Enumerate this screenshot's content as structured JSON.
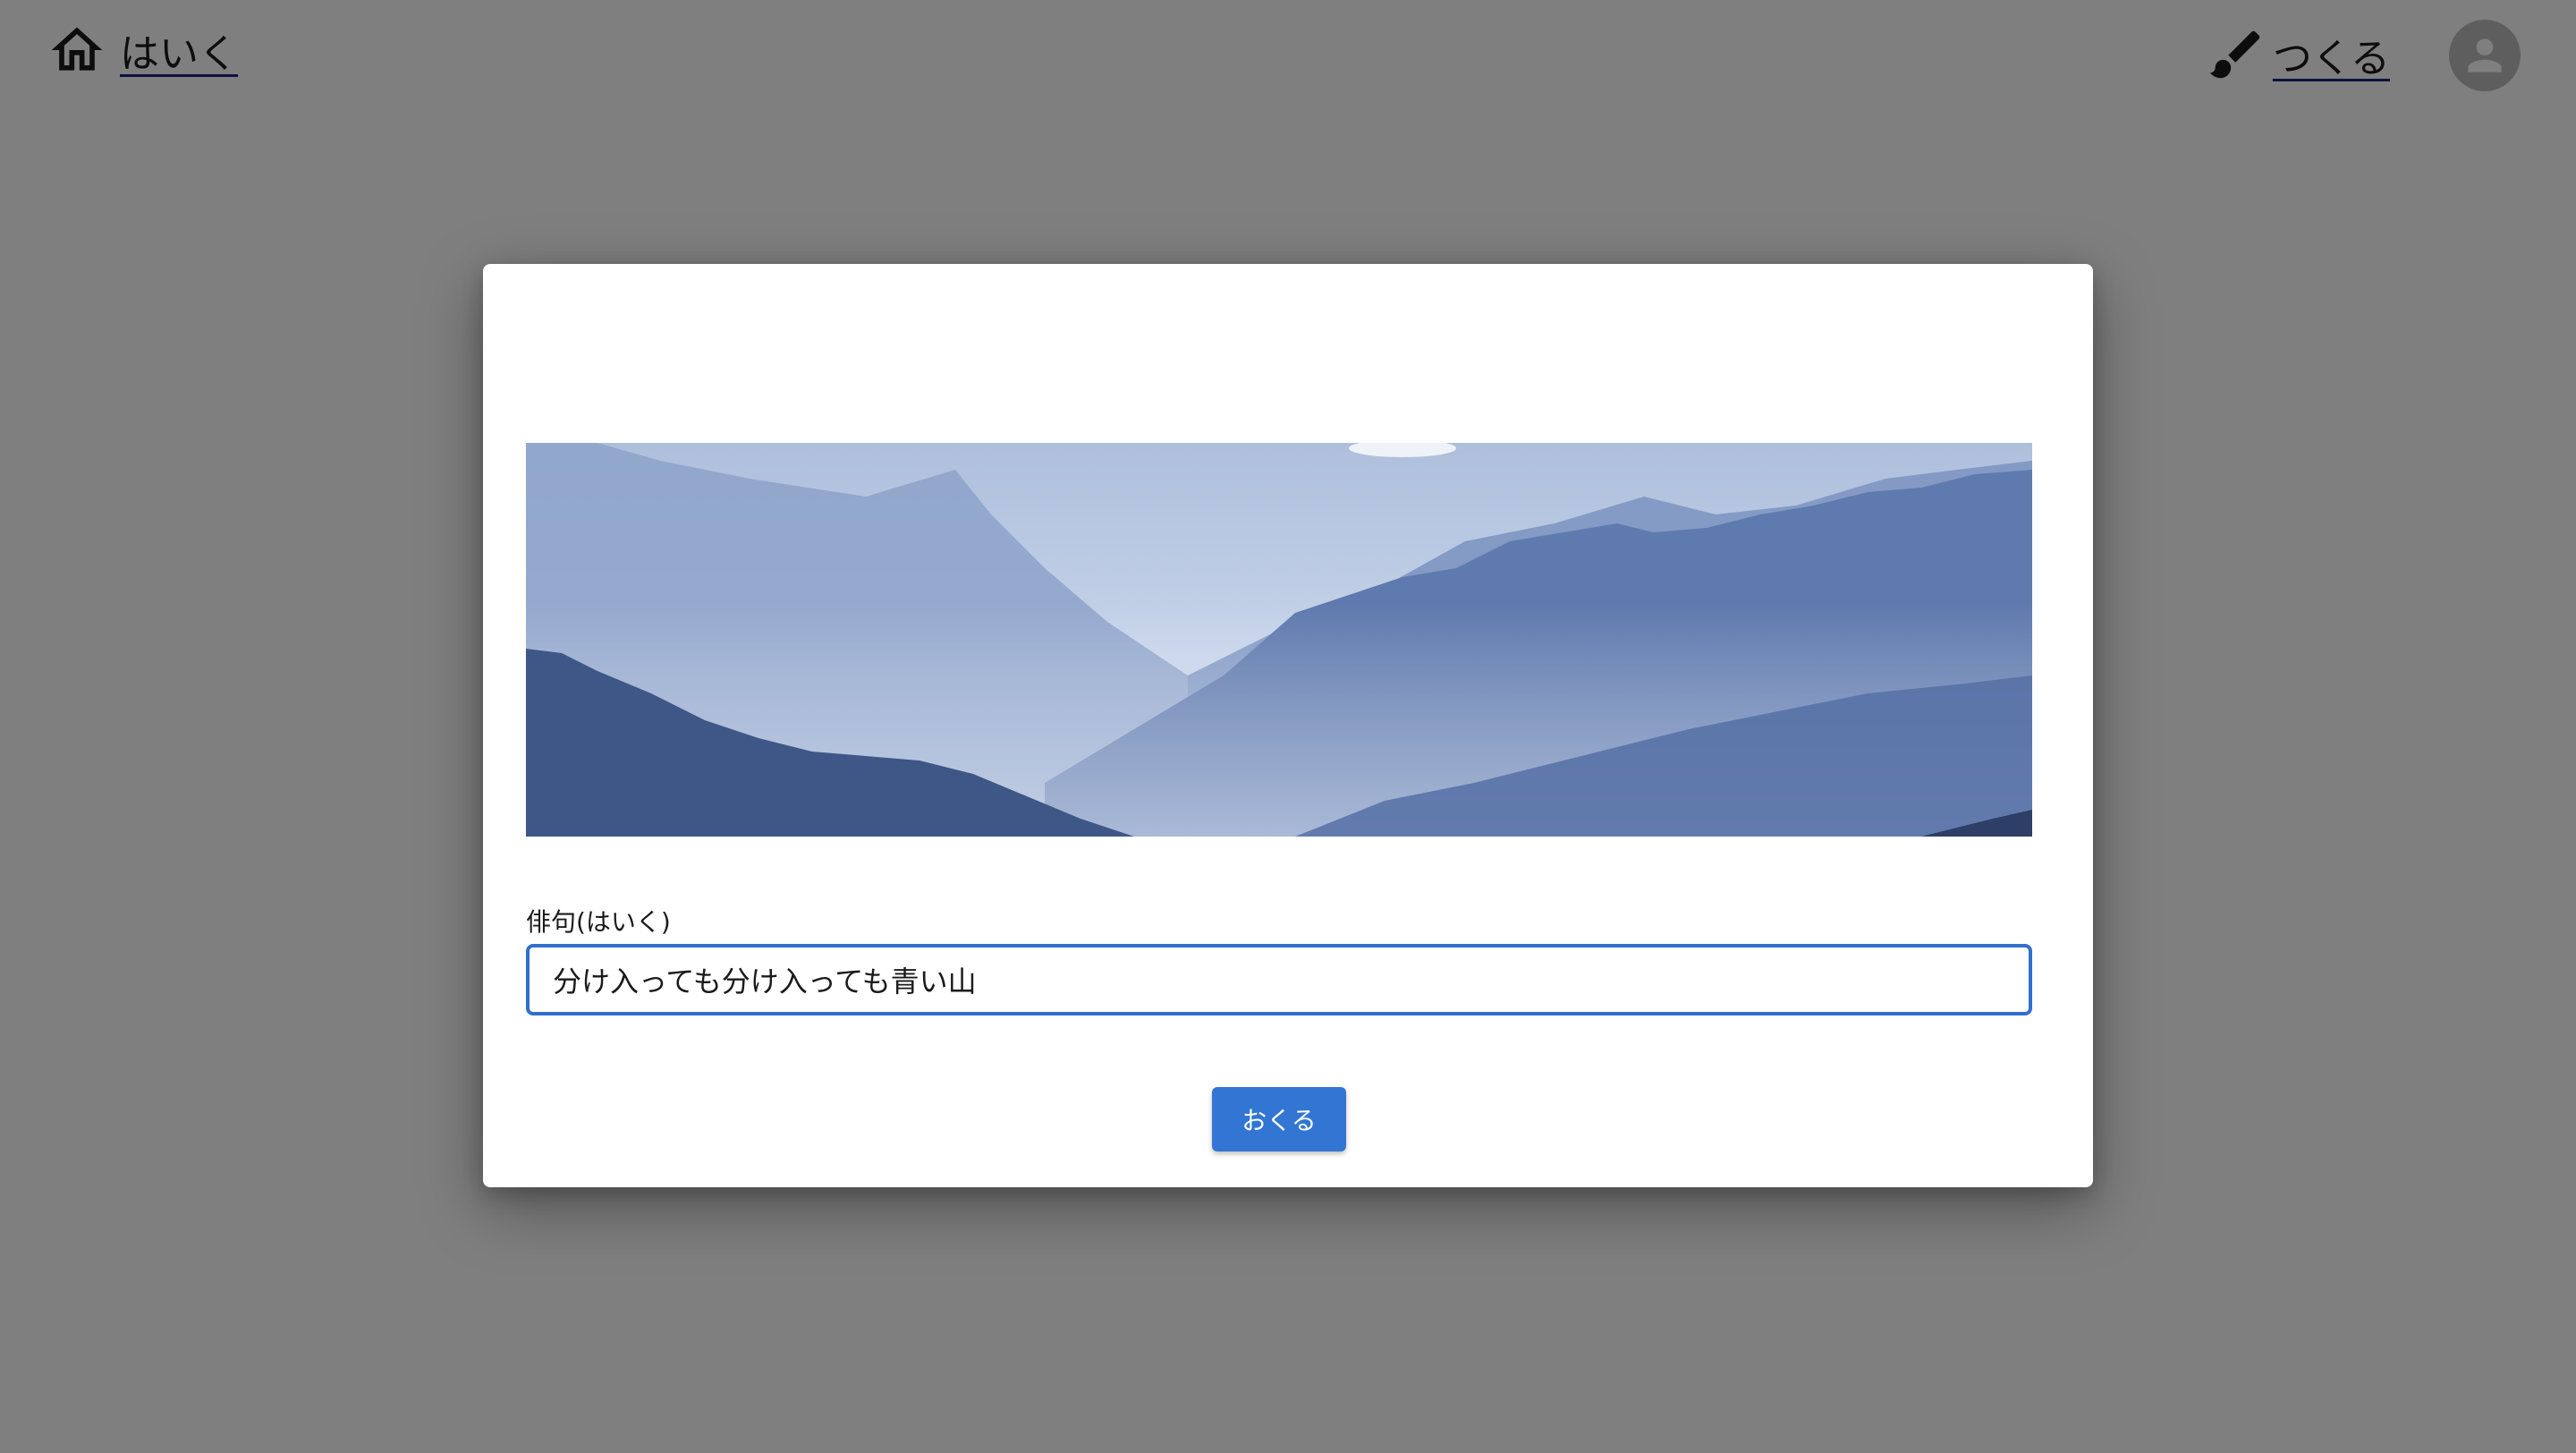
{
  "header": {
    "home_label": "はいく",
    "create_label": "つくる"
  },
  "icons": {
    "home": "home-icon",
    "create": "brush-icon",
    "avatar": "account-icon"
  },
  "dialog": {
    "field_label": "俳句(はいく)",
    "haiku_value": "分け入っても分け入っても青い山",
    "submit_label": "おくる"
  },
  "colors": {
    "accent": "#3275d3",
    "input_border": "#2f6fcf",
    "backdrop": "rgba(0,0,0,0.5)"
  }
}
